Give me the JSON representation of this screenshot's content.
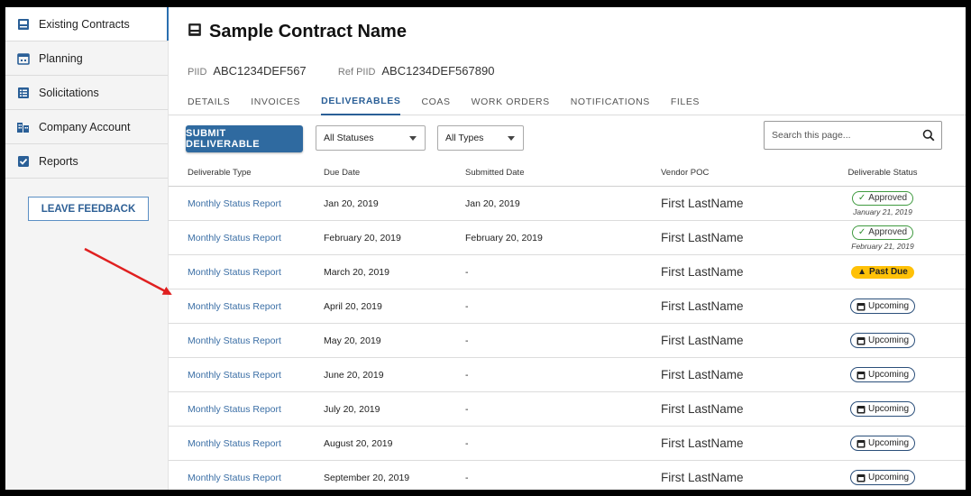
{
  "sidebar": {
    "items": [
      {
        "label": "Existing Contracts",
        "icon": "contract-icon"
      },
      {
        "label": "Planning",
        "icon": "calendar-icon"
      },
      {
        "label": "Solicitations",
        "icon": "list-icon"
      },
      {
        "label": "Company Account",
        "icon": "building-icon"
      },
      {
        "label": "Reports",
        "icon": "checkbox-icon"
      }
    ],
    "feedback_label": "LEAVE FEEDBACK"
  },
  "header": {
    "title": "Sample Contract Name",
    "piid_label": "PIID",
    "piid_value": "ABC1234DEF567",
    "ref_piid_label": "Ref PIID",
    "ref_piid_value": "ABC1234DEF567890"
  },
  "tabs": [
    {
      "label": "DETAILS"
    },
    {
      "label": "INVOICES"
    },
    {
      "label": "DELIVERABLES"
    },
    {
      "label": "COAS"
    },
    {
      "label": "WORK ORDERS"
    },
    {
      "label": "NOTIFICATIONS"
    },
    {
      "label": "FILES"
    }
  ],
  "active_tab": "DELIVERABLES",
  "toolbar": {
    "submit_label": "SUBMIT DELIVERABLE",
    "status_filter": "All Statuses",
    "type_filter": "All Types",
    "search_placeholder": "Search this page..."
  },
  "table": {
    "columns": [
      "Deliverable Type",
      "Due Date",
      "Submitted Date",
      "Vendor POC",
      "Deliverable Status"
    ],
    "rows": [
      {
        "type": "Monthly Status Report",
        "due": "Jan 20, 2019",
        "submitted": "Jan 20, 2019",
        "poc": "First LastName",
        "status": "Approved",
        "status_date": "January 21, 2019"
      },
      {
        "type": "Monthly Status Report",
        "due": "February 20, 2019",
        "submitted": "February 20, 2019",
        "poc": "First LastName",
        "status": "Approved",
        "status_date": "February 21, 2019"
      },
      {
        "type": "Monthly Status Report",
        "due": "March 20, 2019",
        "submitted": "-",
        "poc": "First LastName",
        "status": "Past Due",
        "status_date": ""
      },
      {
        "type": "Monthly Status Report",
        "due": "April 20, 2019",
        "submitted": "-",
        "poc": "First LastName",
        "status": "Upcoming",
        "status_date": ""
      },
      {
        "type": "Monthly Status Report",
        "due": "May 20, 2019",
        "submitted": "-",
        "poc": "First LastName",
        "status": "Upcoming",
        "status_date": ""
      },
      {
        "type": "Monthly Status Report",
        "due": "June 20, 2019",
        "submitted": "-",
        "poc": "First LastName",
        "status": "Upcoming",
        "status_date": ""
      },
      {
        "type": "Monthly Status Report",
        "due": "July 20, 2019",
        "submitted": "-",
        "poc": "First LastName",
        "status": "Upcoming",
        "status_date": ""
      },
      {
        "type": "Monthly Status Report",
        "due": "August 20, 2019",
        "submitted": "-",
        "poc": "First LastName",
        "status": "Upcoming",
        "status_date": ""
      },
      {
        "type": "Monthly Status Report",
        "due": "September 20, 2019",
        "submitted": "-",
        "poc": "First LastName",
        "status": "Upcoming",
        "status_date": ""
      }
    ]
  },
  "colors": {
    "accent": "#2f6aa0",
    "link": "#3a6ea5",
    "approved": "#3f9a3f",
    "past_due": "#ffc107",
    "upcoming_border": "#2b4f7a",
    "annotation_arrow": "#e02020"
  }
}
